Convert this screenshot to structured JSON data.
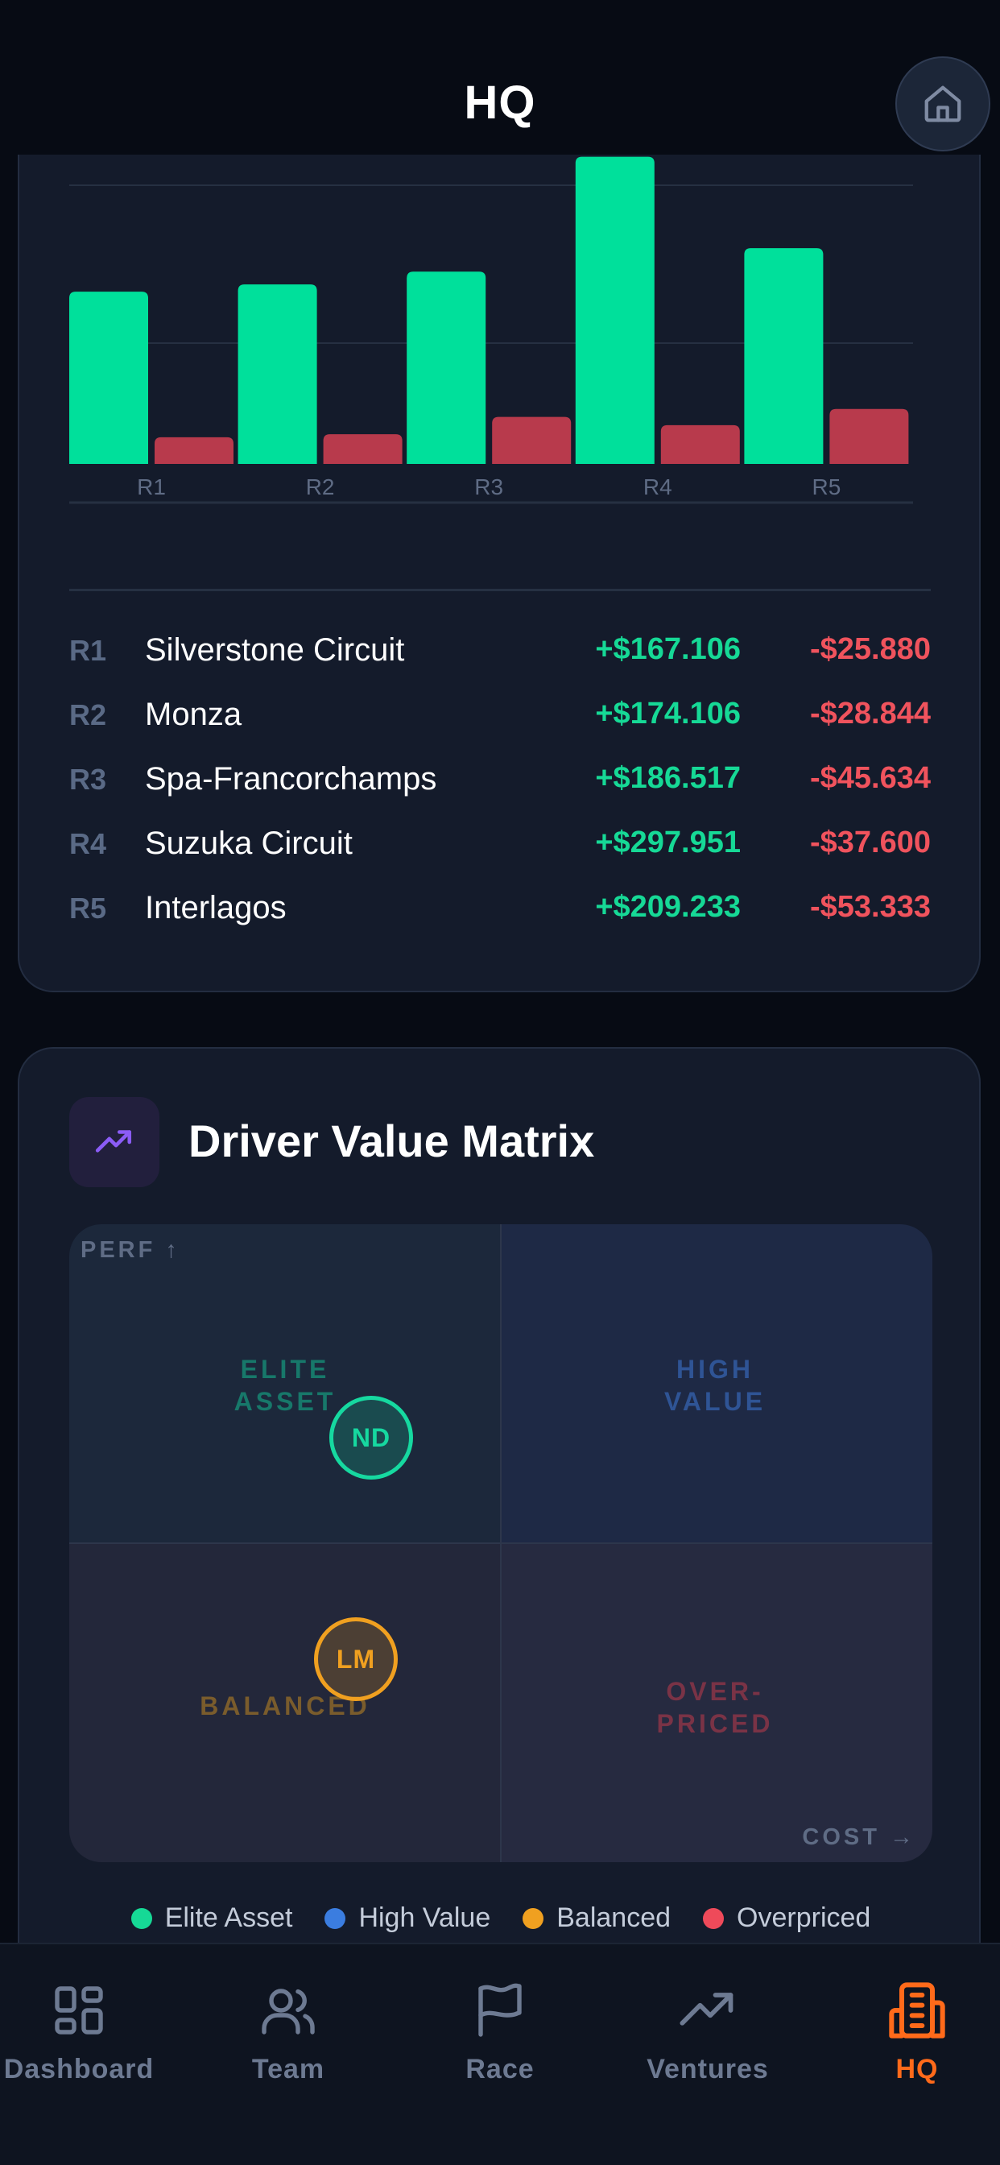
{
  "header": {
    "title": "HQ",
    "home_icon": "home-icon"
  },
  "chart_data": {
    "type": "bar",
    "categories": [
      "R1",
      "R2",
      "R3",
      "R4",
      "R5"
    ],
    "series": [
      {
        "values": [
          167.106,
          174.106,
          186.517,
          297.951,
          209.233
        ],
        "color": "#00e09b"
      },
      {
        "values": [
          25.88,
          28.844,
          45.634,
          37.6,
          53.333
        ],
        "color": "#b83a4c"
      }
    ],
    "ylim": [
      0,
      300
    ],
    "grid": true
  },
  "rounds": [
    {
      "id": "R1",
      "name": "Silverstone Circuit",
      "income": "+$167.106",
      "cost": "-$25.880"
    },
    {
      "id": "R2",
      "name": "Monza",
      "income": "+$174.106",
      "cost": "-$28.844"
    },
    {
      "id": "R3",
      "name": "Spa-Francorchamps",
      "income": "+$186.517",
      "cost": "-$45.634"
    },
    {
      "id": "R4",
      "name": "Suzuka Circuit",
      "income": "+$297.951",
      "cost": "-$37.600"
    },
    {
      "id": "R5",
      "name": "Interlagos",
      "income": "+$209.233",
      "cost": "-$53.333"
    }
  ],
  "matrix": {
    "title": "Driver Value Matrix",
    "icon": "trending-up-icon",
    "y_axis": "PERF ↑",
    "x_axis": "COST →",
    "quadrants": {
      "elite": {
        "line1": "ELITE",
        "line2": "ASSET",
        "color": "#17786a"
      },
      "high": {
        "line1": "HIGH",
        "line2": "VALUE",
        "color": "#2f5495"
      },
      "balanced": {
        "line1": "BALANCED",
        "color": "#7a5c2c"
      },
      "over": {
        "line1": "OVER-",
        "line2": "PRICED",
        "color": "#7a3346"
      }
    },
    "drivers": [
      {
        "initials": "ND",
        "color": "#16d9a0"
      },
      {
        "initials": "LM",
        "color": "#f0a020"
      }
    ],
    "legend": [
      {
        "label": "Elite Asset",
        "color": "#16d996"
      },
      {
        "label": "High Value",
        "color": "#3b7de0"
      },
      {
        "label": "Balanced",
        "color": "#f0a020"
      },
      {
        "label": "Overpriced",
        "color": "#ef4a5a"
      }
    ]
  },
  "nav": [
    {
      "label": "Dashboard",
      "icon": "grid-icon",
      "active": false
    },
    {
      "label": "Team",
      "icon": "users-icon",
      "active": false
    },
    {
      "label": "Race",
      "icon": "flag-icon",
      "active": false
    },
    {
      "label": "Ventures",
      "icon": "trending-up-icon",
      "active": false
    },
    {
      "label": "HQ",
      "icon": "building-icon",
      "active": true
    }
  ]
}
